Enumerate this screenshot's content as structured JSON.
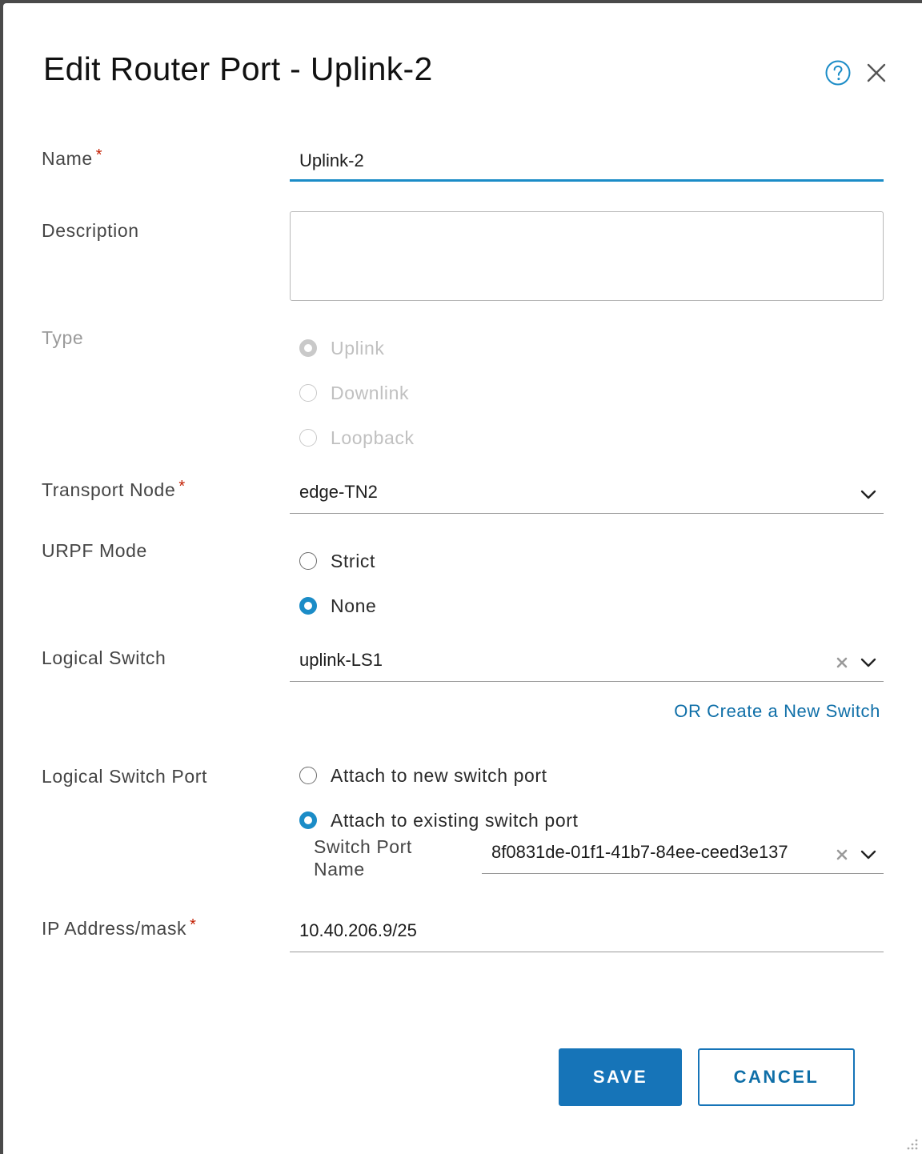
{
  "dialog": {
    "title": "Edit Router Port - Uplink-2",
    "help_icon": "question-circle-icon",
    "close_icon": "close-x-icon"
  },
  "fields": {
    "name": {
      "label": "Name",
      "required": "*",
      "value": "Uplink-2"
    },
    "description": {
      "label": "Description",
      "value": ""
    },
    "type": {
      "label": "Type",
      "options": [
        "Uplink",
        "Downlink",
        "Loopback"
      ],
      "selected": "Uplink",
      "disabled": true
    },
    "transport_node": {
      "label": "Transport Node",
      "required": "*",
      "value": "edge-TN2"
    },
    "urpf_mode": {
      "label": "URPF Mode",
      "options": [
        "Strict",
        "None"
      ],
      "selected": "None"
    },
    "logical_switch": {
      "label": "Logical Switch",
      "value": "uplink-LS1",
      "create_link": "OR Create a New Switch"
    },
    "logical_switch_port": {
      "label": "Logical Switch Port",
      "options": [
        "Attach to new switch port",
        "Attach to existing switch port"
      ],
      "selected": "Attach to existing switch port",
      "switch_port_name_label": "Switch Port Name",
      "switch_port_name_value": "8f0831de-01f1-41b7-84ee-ceed3e137"
    },
    "ip_address": {
      "label": "IP Address/mask",
      "required": "*",
      "value": "10.40.206.9/25"
    }
  },
  "buttons": {
    "save": "SAVE",
    "cancel": "CANCEL"
  },
  "colors": {
    "accent": "#1b8cc7",
    "primary_button": "#1674b8",
    "required": "#c21d00",
    "link": "#0f6fa8"
  }
}
